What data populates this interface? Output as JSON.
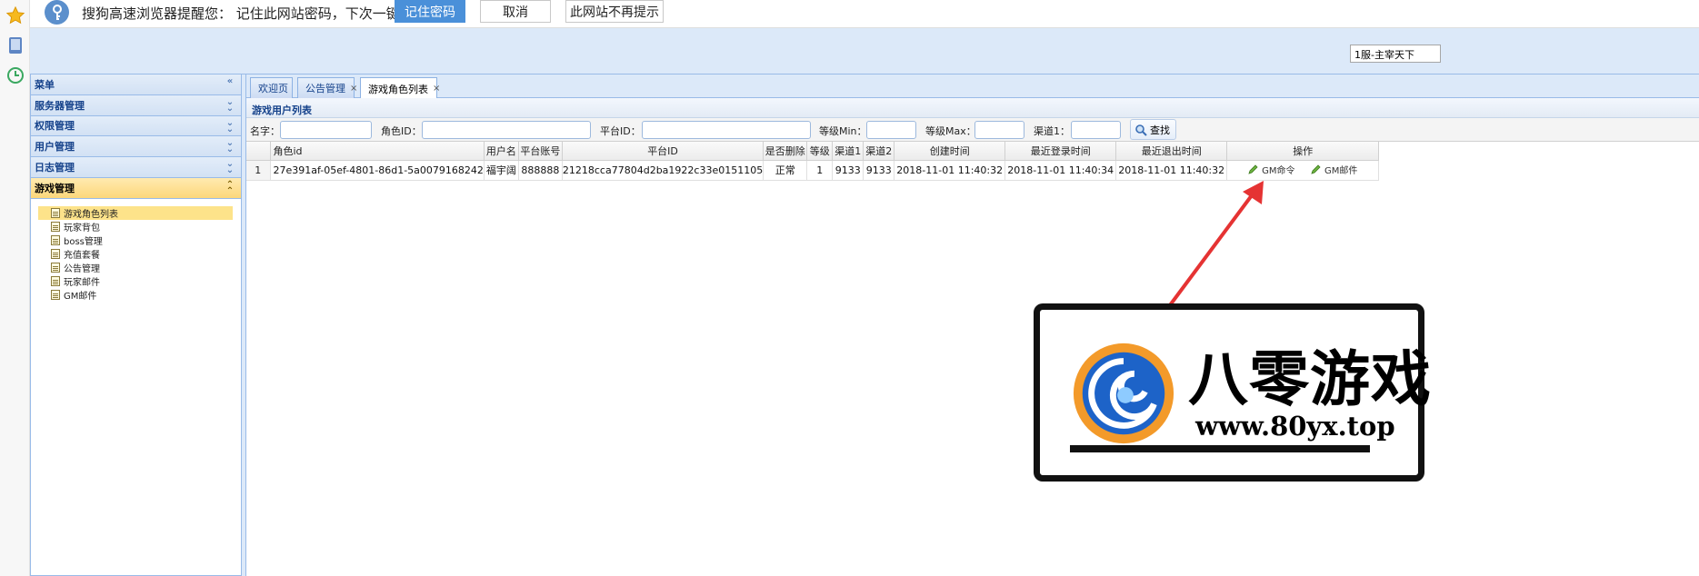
{
  "notify_bar": {
    "message": "搜狗高速浏览器提醒您： 记住此网站密码，下次一键登录！",
    "remember_label": "记住密码",
    "cancel_label": "取消",
    "never_label": "此网站不再提示"
  },
  "header": {
    "server_select": "1服-主宰天下"
  },
  "sidebar": {
    "sections": [
      {
        "label": "菜单"
      },
      {
        "label": "服务器管理"
      },
      {
        "label": "权限管理"
      },
      {
        "label": "用户管理"
      },
      {
        "label": "日志管理"
      },
      {
        "label": "游戏管理"
      }
    ],
    "items": [
      {
        "label": "游戏角色列表"
      },
      {
        "label": "玩家背包"
      },
      {
        "label": "boss管理"
      },
      {
        "label": "充值套餐"
      },
      {
        "label": "公告管理"
      },
      {
        "label": "玩家邮件"
      },
      {
        "label": "GM邮件"
      }
    ]
  },
  "tabs": [
    {
      "label": "欢迎页"
    },
    {
      "label": "公告管理"
    },
    {
      "label": "游戏角色列表"
    }
  ],
  "tab_close_glyph": "×",
  "grid_title": "游戏用户列表",
  "filters": {
    "name_label": "名字：",
    "role_id_label": "角色ID：",
    "platform_id_label": "平台ID：",
    "level_min_label": "等级Min：",
    "level_max_label": "等级Max：",
    "channel_label": "渠道1：",
    "search_label": "查找"
  },
  "table": {
    "columns": [
      "角色id",
      "用户名",
      "平台账号",
      "平台ID",
      "是否删除",
      "等级",
      "渠道1",
      "渠道2",
      "创建时间",
      "最近登录时间",
      "最近退出时间",
      "操作"
    ],
    "rows": [
      {
        "num": "1",
        "role_id": "27e391af-05ef-4801-86d1-5a0079168242",
        "username": "福宇阔",
        "account": "888888",
        "platform_id": "21218cca77804d2ba1922c33e0151105",
        "deleted": "正常",
        "level": "1",
        "channel1": "9133",
        "channel2": "9133",
        "created": "2018-11-01 11:40:32",
        "last_login": "2018-11-01 11:40:34",
        "last_logout": "2018-11-01 11:40:32",
        "op1": "GM命令",
        "op2": "GM邮件"
      }
    ]
  },
  "watermark": {
    "text": "八零游戏",
    "url": "www.80yx.top"
  },
  "colors": {
    "accent": "#4a90d9",
    "header_bg": "#dce9f9",
    "active_section": "#fcd77a",
    "arrow": "#e53333"
  },
  "icons": [
    "star-icon",
    "tablet-icon",
    "clock-icon",
    "key-icon",
    "chevron-icon",
    "document-icon",
    "search-icon",
    "pencil-icon"
  ]
}
